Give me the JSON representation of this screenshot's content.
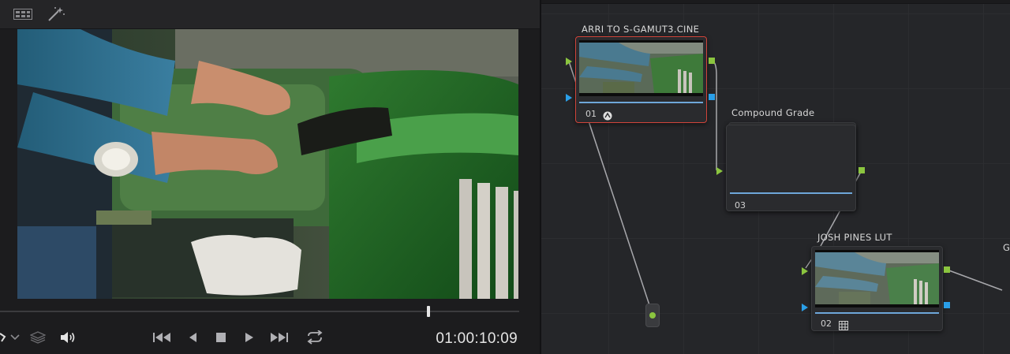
{
  "viewer": {
    "toolbar": {
      "icons": [
        "grid-layout-icon",
        "magic-wand-icon"
      ]
    },
    "transport": {
      "icons": [
        "tool-icon",
        "chevron-down-icon",
        "layers-icon",
        "volume-icon",
        "skip-to-start-icon",
        "step-back-icon",
        "stop-icon",
        "play-icon",
        "skip-to-end-icon",
        "loop-icon"
      ],
      "timecode": "01:00:10:09"
    },
    "playhead_position": 0.86
  },
  "node_graph": {
    "nodes": [
      {
        "title": "ARRI TO S-GAMUT3.CINE",
        "number": "01",
        "badge_icon": "lut-badge-icon",
        "selected": true
      },
      {
        "title": "Compound  Grade",
        "number": "03",
        "badge_icon": "",
        "selected": false
      },
      {
        "title": "JOSH PINES LUT",
        "number": "02",
        "badge_icon": "grid-badge-icon",
        "selected": false
      }
    ],
    "edge_label": "G"
  },
  "colors": {
    "accent_green": "#8bc53f",
    "accent_blue": "#2a9fe8",
    "selection_red": "#d0443a",
    "bar_blue": "#6ea7d9"
  }
}
